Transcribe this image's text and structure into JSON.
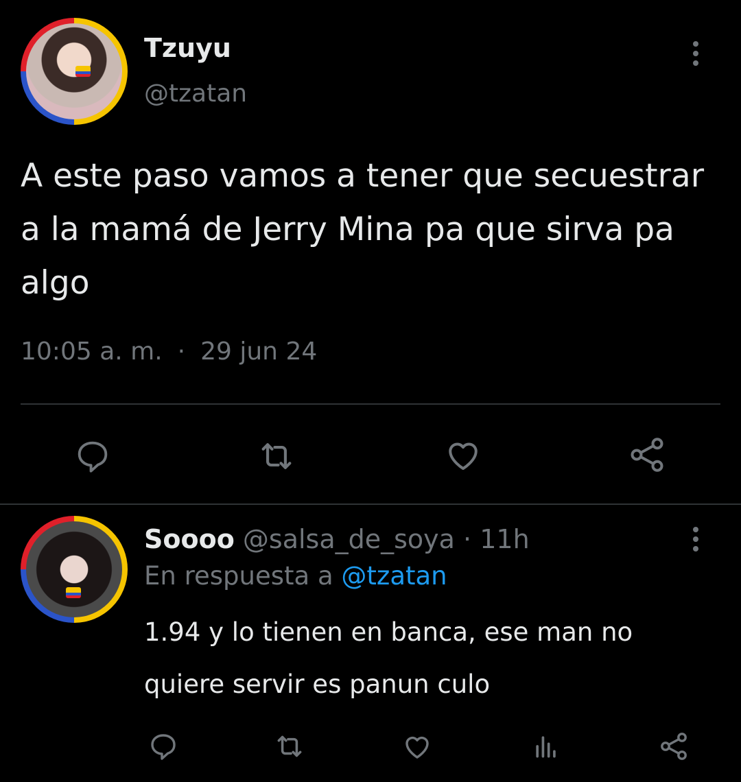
{
  "main_tweet": {
    "display_name": "Tzuyu",
    "handle": "@tzatan",
    "text_lines": [
      "A este paso vamos a tener que secuestrar",
      "a la mamá de Jerry Mina pa que sirva pa",
      "algo"
    ],
    "time": "10:05 a. m.",
    "separator": "·",
    "date": "29 jun 24"
  },
  "reply": {
    "display_name": "Soooo",
    "handle": "@salsa_de_soya",
    "separator": "·",
    "age": "11h",
    "reply_prefix": "En respuesta a",
    "reply_to": "@tzatan",
    "text_lines": [
      "1.94 y lo tienen en banca, ese man no",
      "quiere servir es panun culo"
    ]
  },
  "icons": {
    "main_actions": [
      "reply-icon",
      "retweet-icon",
      "like-icon",
      "share-icon"
    ],
    "reply_actions": [
      "reply-icon",
      "retweet-icon",
      "like-icon",
      "views-icon",
      "share-icon"
    ]
  },
  "colors": {
    "background": "#000000",
    "text": "#e7e9ea",
    "muted": "#71767b",
    "link": "#1d9bf0",
    "divider": "#2f3336"
  }
}
